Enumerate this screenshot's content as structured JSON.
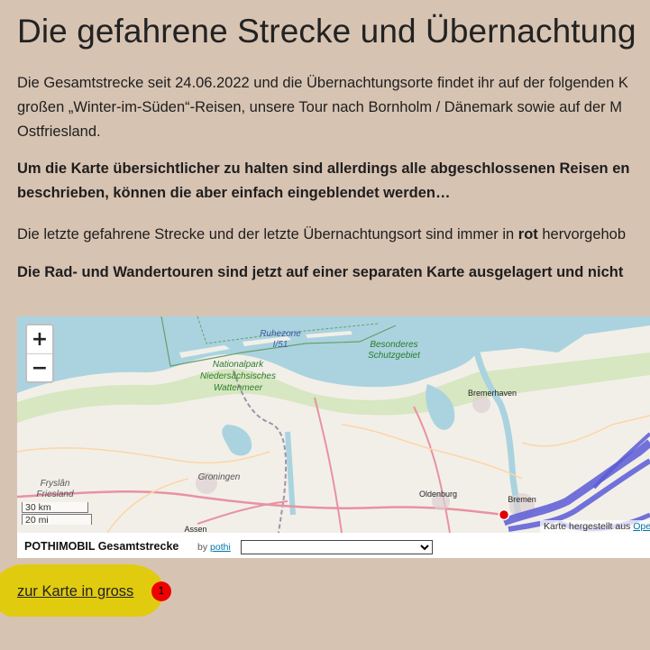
{
  "page_title": "Die gefahrene Strecke und Übernachtung",
  "intro": [
    "Die Gesamtstrecke seit 24.06.2022 und die Übernachtungsorte findet ihr auf der folgenden K",
    "großen „Winter-im-Süden“-Reisen, unsere Tour nach Bornholm / Dänemark sowie auf der M",
    "Ostfriesland."
  ],
  "note_bold": [
    "Um die Karte übersichtlicher zu halten sind allerdings alle abgeschlossenen Reisen en",
    "beschrieben, können die aber einfach eingeblendet werden…"
  ],
  "last_route": {
    "before": "Die letzte gefahrene Strecke und der letzte Übernachtungsort sind immer in ",
    "emph": "rot",
    "after": " hervorgehob"
  },
  "bike_note": "Die Rad- und Wandertouren sind jetzt auf einer separaten Karte ausgelagert und nicht",
  "map": {
    "zoom_in": "+",
    "zoom_out": "−",
    "scale_km": "30 km",
    "scale_mi": "20 mi",
    "attribution_prefix": "Karte hergestellt aus ",
    "attribution_link": "Ope",
    "labels": {
      "ruhezone": "Ruhezone",
      "ruhezone_num": "I/51",
      "besonderes": "Besonderes",
      "schutzgebiet": "Schutzgebiet",
      "np1": "Nationalpark",
      "np2": "Niedersächsisches",
      "np3": "Wattenmeer",
      "bremerhaven": "Bremerhaven",
      "groningen": "Groningen",
      "fryslan": "Fryslân",
      "friesland": "Friesland",
      "oldenburg": "Oldenburg",
      "bremen": "Bremen",
      "assen": "Assen"
    },
    "colors": {
      "route": "#5b5bd6",
      "marker": "#e00000"
    }
  },
  "mapbar": {
    "map_name": "POTHIMOBIL Gesamtstrecke",
    "by_prefix": "by ",
    "by_author": "pothi",
    "select_value": ""
  },
  "big_map_link": "zur Karte in gross",
  "badge_number": "1"
}
